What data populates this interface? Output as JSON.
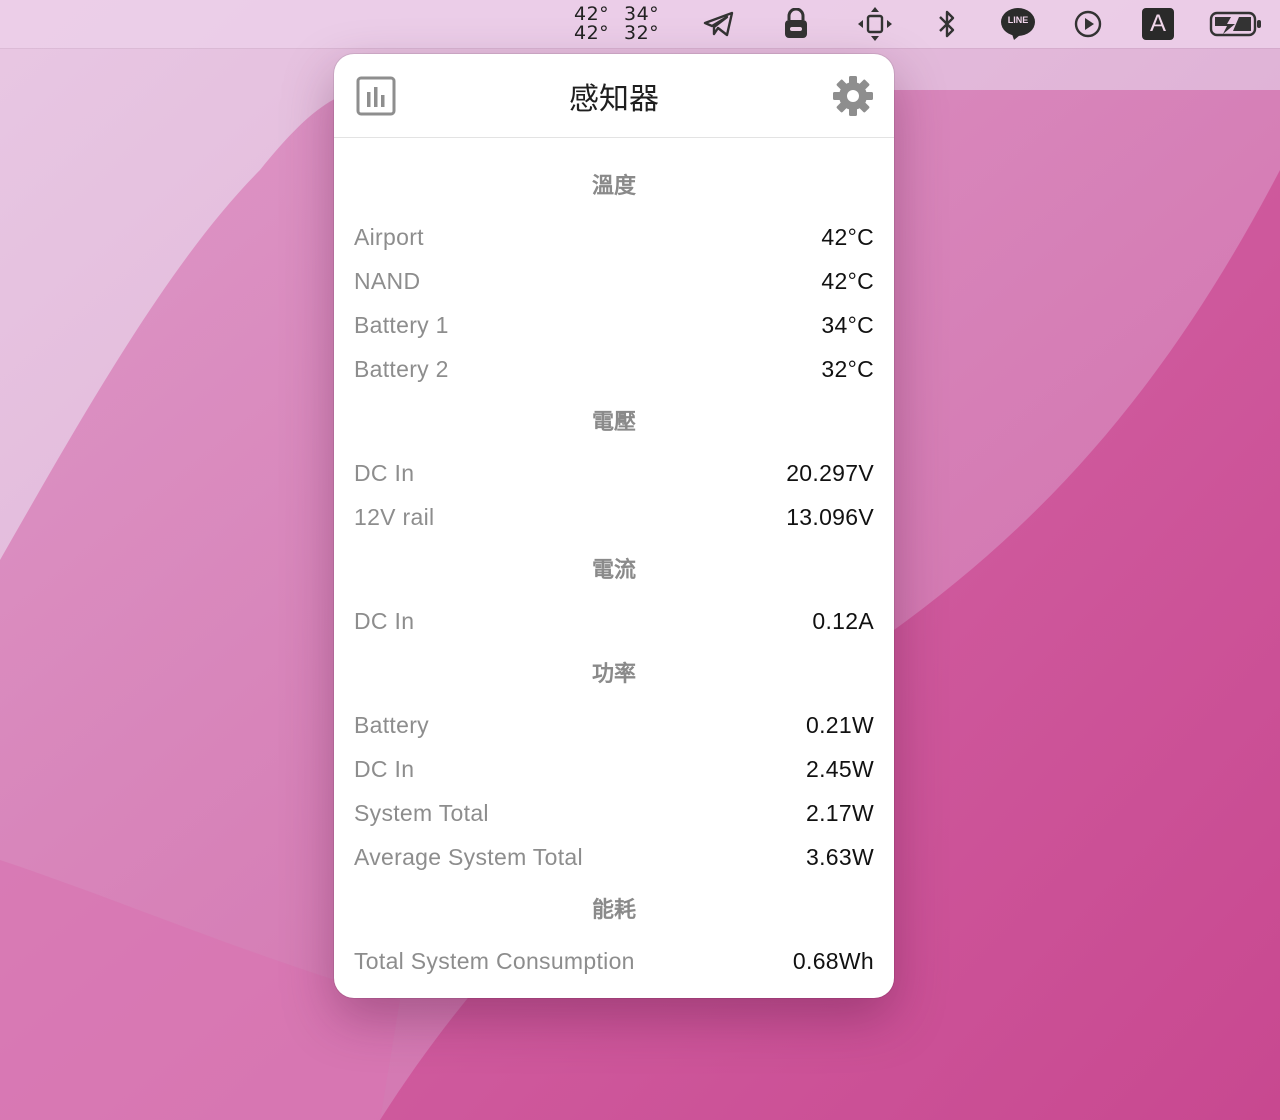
{
  "menubar": {
    "temperatures": {
      "row1": [
        "42°",
        "34°"
      ],
      "row2": [
        "42°",
        "32°"
      ]
    },
    "icons": [
      "telegram-icon",
      "lock-icon",
      "window-move-icon",
      "bluetooth-icon",
      "line-icon",
      "play-icon",
      "input-source-icon",
      "battery-charging-icon"
    ],
    "input_source_label": "A",
    "line_label": "LINE"
  },
  "popover": {
    "title": "感知器",
    "sections": [
      {
        "title": "溫度",
        "rows": [
          {
            "name": "Airport",
            "value": "42°C"
          },
          {
            "name": "NAND",
            "value": "42°C"
          },
          {
            "name": "Battery 1",
            "value": "34°C"
          },
          {
            "name": "Battery 2",
            "value": "32°C"
          }
        ]
      },
      {
        "title": "電壓",
        "rows": [
          {
            "name": "DC In",
            "value": "20.297V"
          },
          {
            "name": "12V rail",
            "value": "13.096V"
          }
        ]
      },
      {
        "title": "電流",
        "rows": [
          {
            "name": "DC In",
            "value": "0.12A"
          }
        ]
      },
      {
        "title": "功率",
        "rows": [
          {
            "name": "Battery",
            "value": "0.21W"
          },
          {
            "name": "DC In",
            "value": "2.45W"
          },
          {
            "name": "System Total",
            "value": "2.17W"
          },
          {
            "name": "Average System Total",
            "value": "3.63W"
          }
        ]
      },
      {
        "title": "能耗",
        "rows": [
          {
            "name": "Total System Consumption",
            "value": "0.68Wh"
          }
        ]
      }
    ]
  },
  "colors": {
    "accent_gray": "#8a8a8a",
    "value_text": "#111111",
    "popover_bg": "#ffffff"
  }
}
